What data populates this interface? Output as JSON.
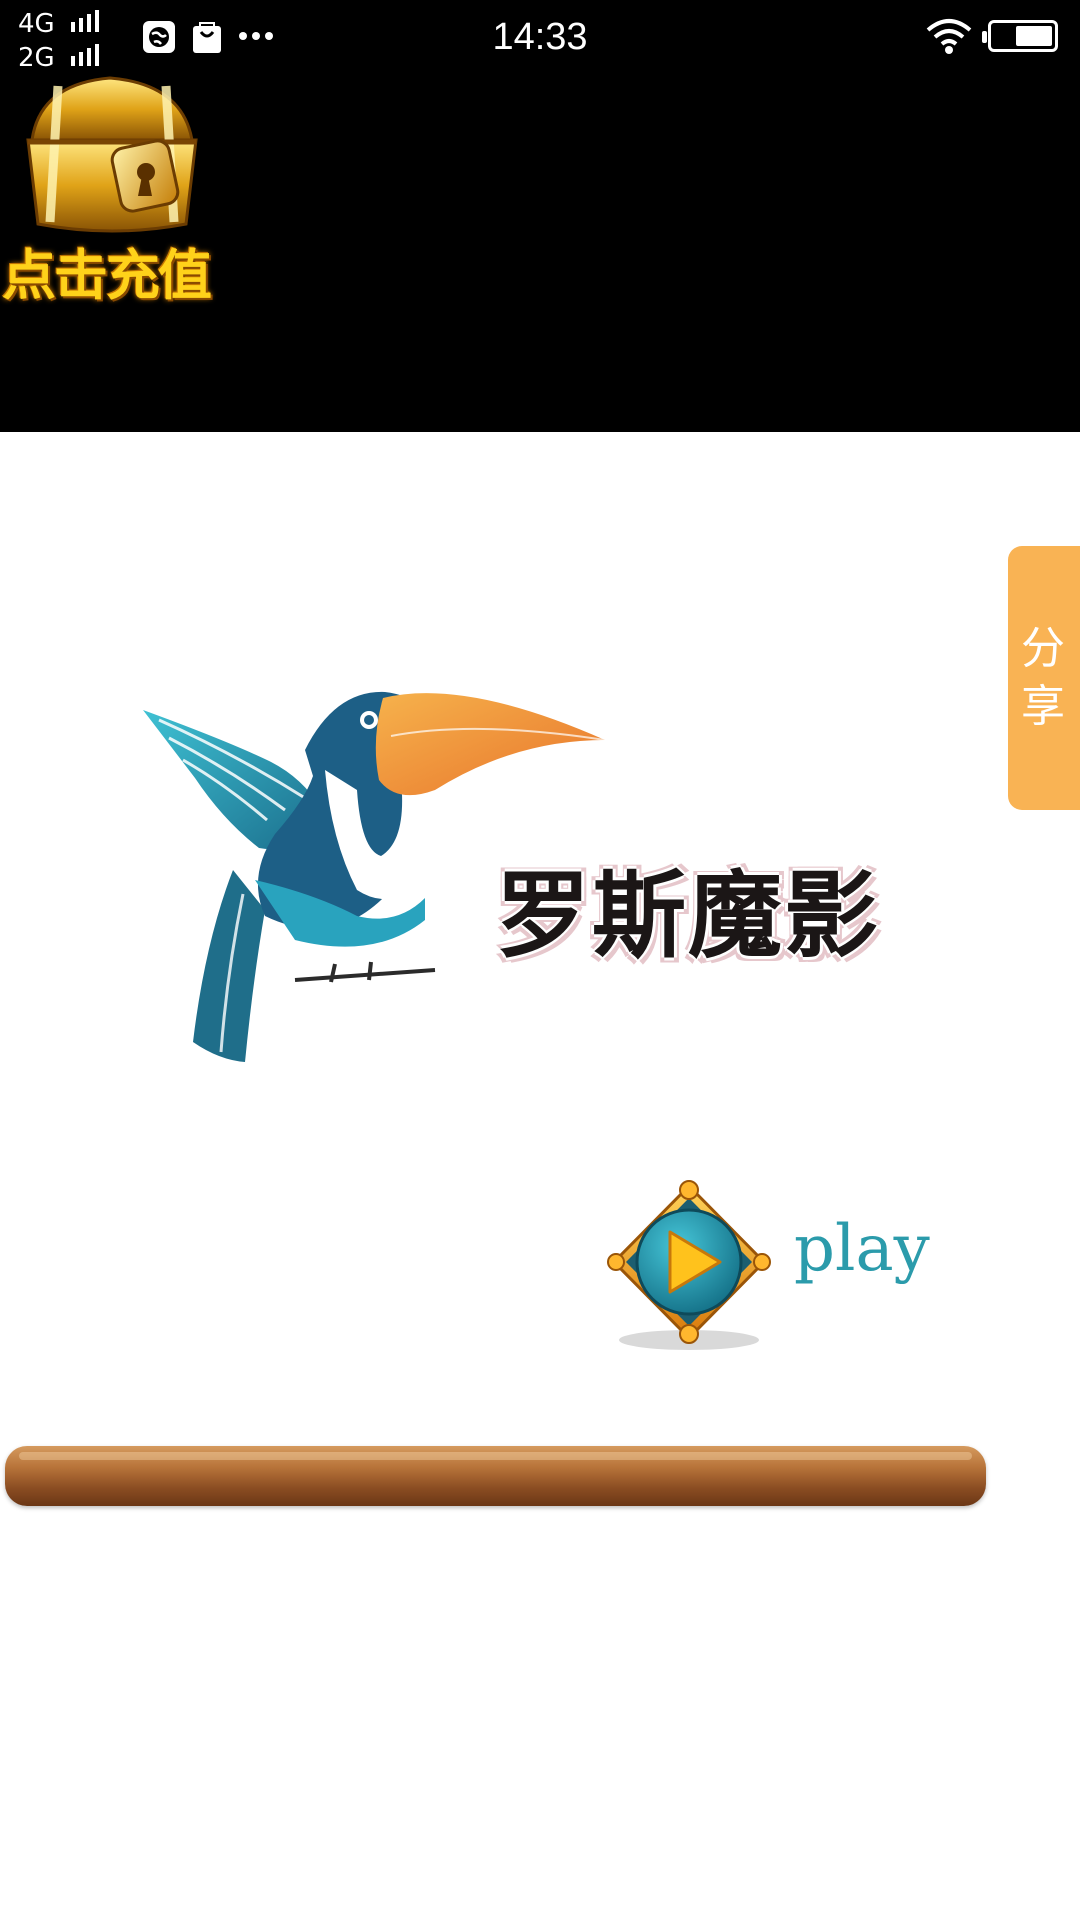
{
  "status_bar": {
    "network_1": "4G",
    "network_2": "2G",
    "time": "14:33",
    "icons": [
      "browser-icon",
      "store-icon",
      "more-icon",
      "wifi-icon",
      "battery-icon"
    ]
  },
  "recharge": {
    "label": "点击充值",
    "icon": "treasure-chest-icon"
  },
  "share_tab": {
    "label": "分享",
    "color": "#f9b354"
  },
  "logo": {
    "icon": "toucan-logo",
    "title": "罗斯魔影"
  },
  "play": {
    "label": "play",
    "icon": "play-icon",
    "color": "#2b9bab"
  },
  "colors": {
    "top_band": "#000000",
    "background": "#ffffff",
    "recharge_text": "#ffd21a"
  }
}
